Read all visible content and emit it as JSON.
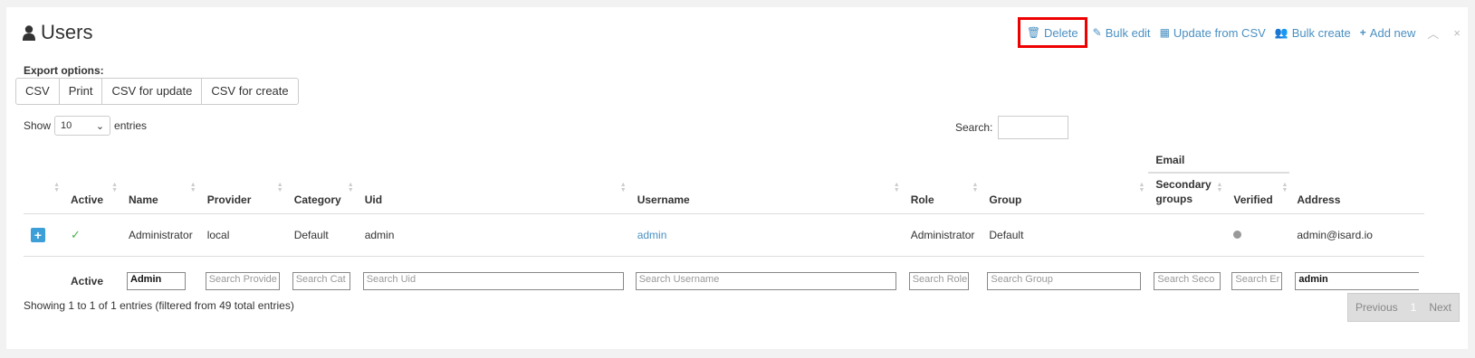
{
  "title": "Users",
  "toolbar": {
    "delete": "Delete",
    "bulk_edit": "Bulk edit",
    "update_csv": "Update from CSV",
    "bulk_create": "Bulk create",
    "add_new": "Add new",
    "collapse": "^",
    "close": "×"
  },
  "export": {
    "label": "Export options:",
    "buttons": [
      "CSV",
      "Print",
      "CSV for update",
      "CSV for create"
    ]
  },
  "show": {
    "prefix": "Show",
    "value": "10",
    "suffix": "entries"
  },
  "search": {
    "label": "Search:"
  },
  "table": {
    "group_header": "Email",
    "headers": [
      "Active",
      "Name",
      "Provider",
      "Category",
      "Uid",
      "Username",
      "Role",
      "Group",
      "Secondary groups",
      "Verified",
      "Address"
    ],
    "row": {
      "name": "Administrator",
      "provider": "local",
      "category": "Default",
      "uid": "admin",
      "username": "admin",
      "role": "Administrator",
      "group": "Default",
      "address": "admin@isard.io"
    },
    "filters": {
      "active": "Active",
      "name": "Admin",
      "provider": "Search Provide",
      "category": "Search Cat",
      "uid": "Search Uid",
      "username": "Search Username",
      "role": "Search Role",
      "group": "Search Group",
      "secondary": "Search Seco",
      "verified": "Search Er",
      "address": "admin"
    }
  },
  "info": "Showing 1 to 1 of 1 entries (filtered from 49 total entries)",
  "pager": {
    "previous": "Previous",
    "page": "1",
    "next": "Next"
  }
}
